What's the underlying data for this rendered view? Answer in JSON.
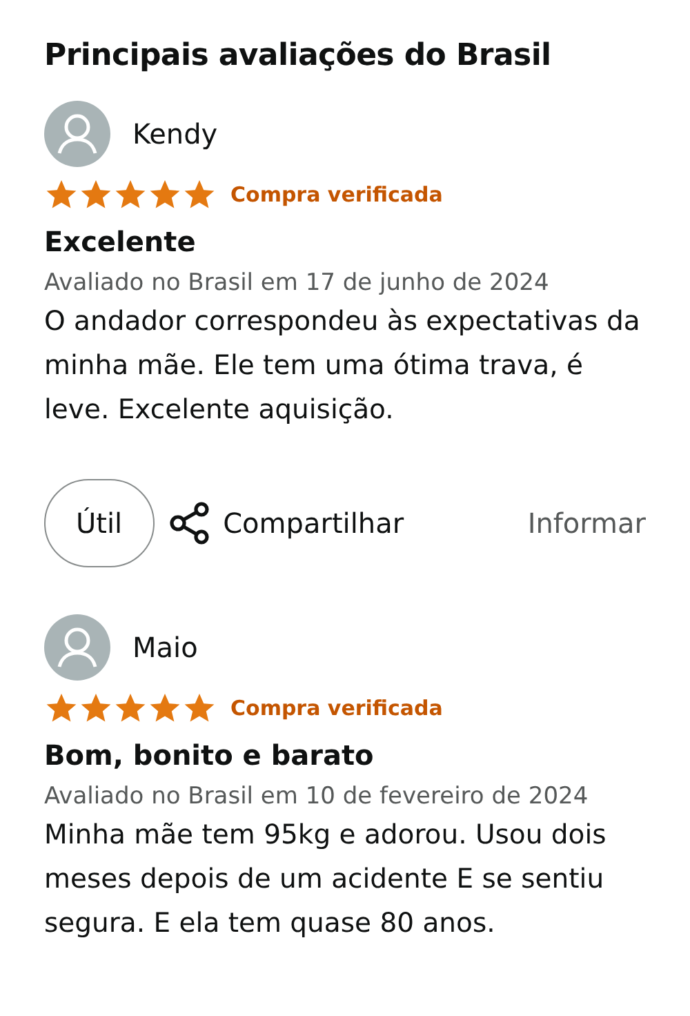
{
  "heading": "Principais avaliações do Brasil",
  "reviews": [
    {
      "author": "Kendy",
      "stars": 5,
      "badge": "Compra verificada",
      "title": "Excelente",
      "date": "Avaliado no Brasil em 17 de junho de 2024",
      "body": "O andador correspondeu às expectativas da minha mãe. Ele tem uma ótima trava, é leve. Excelente aquisição.",
      "actions": {
        "helpful": "Útil",
        "share": "Compartilhar",
        "report": "Informar"
      }
    },
    {
      "author": "Maio",
      "stars": 5,
      "badge": "Compra verificada",
      "title": "Bom, bonito e barato",
      "date": "Avaliado no Brasil em 10 de fevereiro de 2024",
      "body": "Minha mãe tem 95kg e adorou. Usou dois meses depois de um acidente E se sentiu segura. E ela tem quase 80 anos."
    }
  ]
}
